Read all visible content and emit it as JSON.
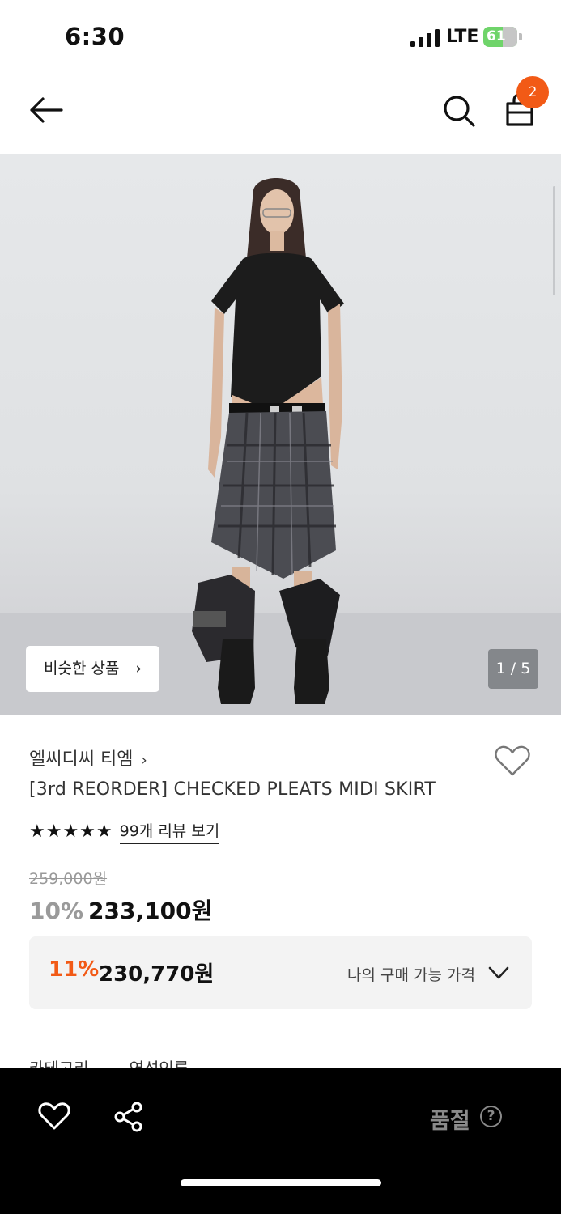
{
  "status_bar": {
    "time": "6:30",
    "network": "LTE",
    "battery": "61"
  },
  "header": {
    "cart_count": "2"
  },
  "hero": {
    "similar_button_label": "비슷한 상품",
    "chevron": "›",
    "counter": "1 / 5"
  },
  "product": {
    "brand": "엘씨디씨 티엠",
    "brand_chevron": "›",
    "title": "[3rd REORDER] CHECKED PLEATS MIDI SKIRT",
    "stars": "★★★★★",
    "rating_value": 5,
    "review_link": "99개 리뷰 보기",
    "original_price": "259,000원",
    "discount": "10%",
    "price": "233,100원"
  },
  "best_price": {
    "discount": "11%",
    "price": "230,770원",
    "label": "나의 구매 가능 가격"
  },
  "tabs_partial": [
    "카테고리",
    "연성인류"
  ],
  "bottom_bar": {
    "soldout_label": "품절",
    "help_icon": "?"
  },
  "colors": {
    "accent": "#f25a16",
    "badge": "#f25a16",
    "bottom_bar": "#000000"
  },
  "icons": [
    "back-arrow-icon",
    "search-icon",
    "cart-icon",
    "heart-icon",
    "share-icon",
    "chevron-down-icon",
    "help-icon",
    "signal-icon"
  ]
}
